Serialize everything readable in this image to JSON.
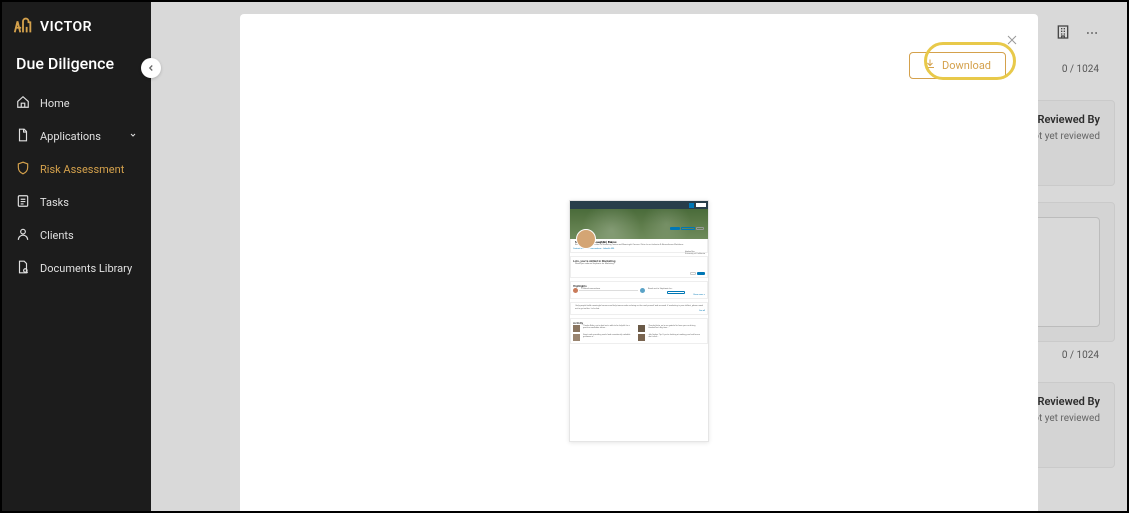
{
  "brand": {
    "name": "VICTOR"
  },
  "section_title": "Due Diligence",
  "nav": {
    "home": "Home",
    "applications": "Applications",
    "risk_assessment": "Risk Assessment",
    "tasks": "Tasks",
    "clients": "Clients",
    "documents_library": "Documents Library"
  },
  "counters": {
    "c1": "0 / 1024",
    "c2": "0 / 1024"
  },
  "cards": {
    "reviewed_by_label": "Last Reviewed By",
    "not_reviewed": "Not yet reviewed"
  },
  "modal": {
    "download_label": "Download"
  },
  "preview": {
    "name": "Stephanie (McLaughlin) Bairos",
    "tagline": "Recruitment Expert | Builder of Marketing Teams and Meaningful Careers | Drive for an Inclusive & Neurodiverse Workforce",
    "company": "HackerOne",
    "school": "University of California",
    "links": "Contact info · 500+ connections · LinkedIn URL",
    "skilled_in": "Lots, you're skilled in Marketing",
    "skilled_sub": "Would you endorse Stephanie for Marketing?",
    "highlights_title": "Highlights",
    "hl1": "2 Mutual connections",
    "hl2": "Reach out to Stephanie for...",
    "msg_btn": "Message Stephanie",
    "about_text": "I help people build meaningful careers and help teams scale as being on the road yourself and succeed. If marketing is your skillset, please reach out to get coffee. Let's chat.",
    "see_all": "See all",
    "activity_title": "Activity",
    "act1": "Thanks Raka, we're glad we're able to be helpful for a positive candidate series...",
    "act2": "Thanks Anita, we're so grateful to have you on driving HackerOne's big time...",
    "act3": "Great work providing useful and consistently valuable guidance w...",
    "act4": "Job Seeker Tip: If you're looking at making your bold move don't click..."
  }
}
